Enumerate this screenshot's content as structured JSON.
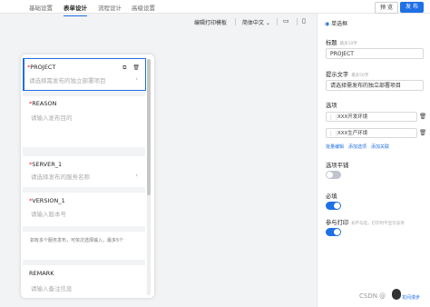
{
  "tabs": [
    {
      "label": "基础设置"
    },
    {
      "label": "表单设计"
    },
    {
      "label": "流程设计"
    },
    {
      "label": "高级设置"
    }
  ],
  "actions": {
    "preview": "预 览",
    "publish": "发 布"
  },
  "toolbar": {
    "print_template": "编辑打印模板",
    "language": "简体中文 ⌄"
  },
  "form": {
    "fields": [
      {
        "label": "PROJECT",
        "placeholder": "请选择需发布的独立部署项目",
        "required": "*"
      },
      {
        "label": "REASON",
        "placeholder": "请输入发布目的",
        "required": "*"
      },
      {
        "label": "SERVER_1",
        "placeholder": "请选择发布的服务名称",
        "required": "*"
      },
      {
        "label": "VERSION_1",
        "placeholder": "请输入版本号",
        "required": "*"
      },
      {
        "note": "如有多个服务发布，可依次选择输入，最多5个"
      },
      {
        "label": "REMARK",
        "placeholder": "请输入备注信息"
      }
    ]
  },
  "panel": {
    "component_type": "单选框",
    "title_label": "标题",
    "title_hint": "最多10字",
    "title_value": "PROJECT",
    "prompt_label": "提示文字",
    "prompt_hint": "最多50字",
    "prompt_value": "请选择需发布的独立部署项目",
    "options_label": "选项",
    "options": [
      "XXX开发环境",
      "XXX生产环境"
    ],
    "option_links": [
      "批量编辑",
      "添加选项",
      "添加关联"
    ],
    "tile_label": "选项平铺",
    "required_label": "必填",
    "print_label": "参与打印",
    "print_hint": "如不勾选，打印时不显示该项",
    "tile_on": false,
    "required_on": true,
    "print_on": true
  },
  "watermark": {
    "text": "CSDN @",
    "user": "花间漫步"
  },
  "colors": {
    "accent": "#1f6fe5",
    "required": "#f5222d"
  }
}
